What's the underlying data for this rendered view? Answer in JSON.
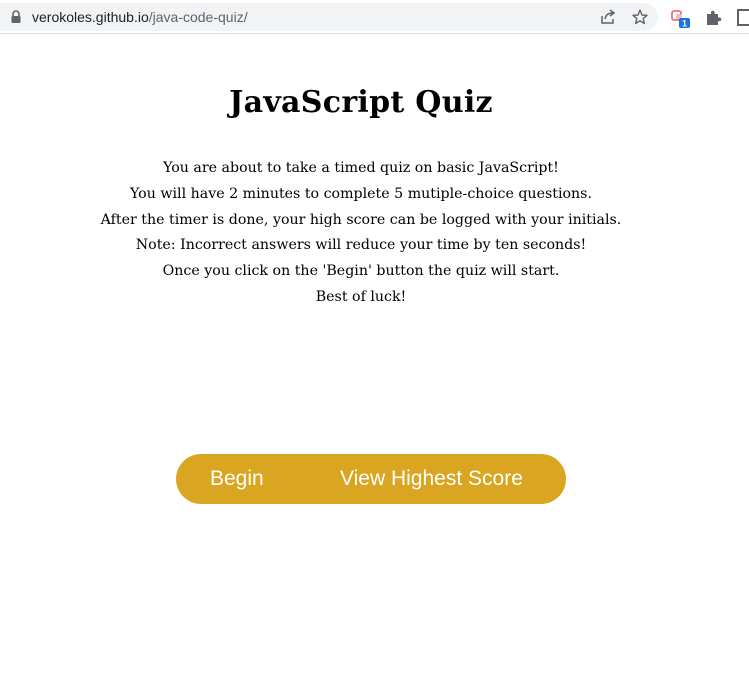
{
  "browser": {
    "url_host": "verokoles.github.io",
    "url_path": "/java-code-quiz/",
    "extension_badge_count": "1"
  },
  "quiz": {
    "title": "JavaScript Quiz",
    "instructions": [
      "You are about to take a timed quiz on basic JavaScript!",
      "You will have 2 minutes to complete 5 mutiple-choice questions.",
      "After the timer is done, your high score can be logged with your initials.",
      "Note: Incorrect answers will reduce your time by ten seconds!",
      "Once you click on the 'Begin' button the quiz will start.",
      "Best of luck!"
    ],
    "begin_label": "Begin",
    "high_score_label": "View Highest Score"
  },
  "colors": {
    "button_bar": "#daa520",
    "button_text": "#ffffff"
  },
  "icons": [
    "lock-icon",
    "share-icon",
    "star-icon",
    "extension-icon",
    "puzzle-icon",
    "window-icon"
  ]
}
